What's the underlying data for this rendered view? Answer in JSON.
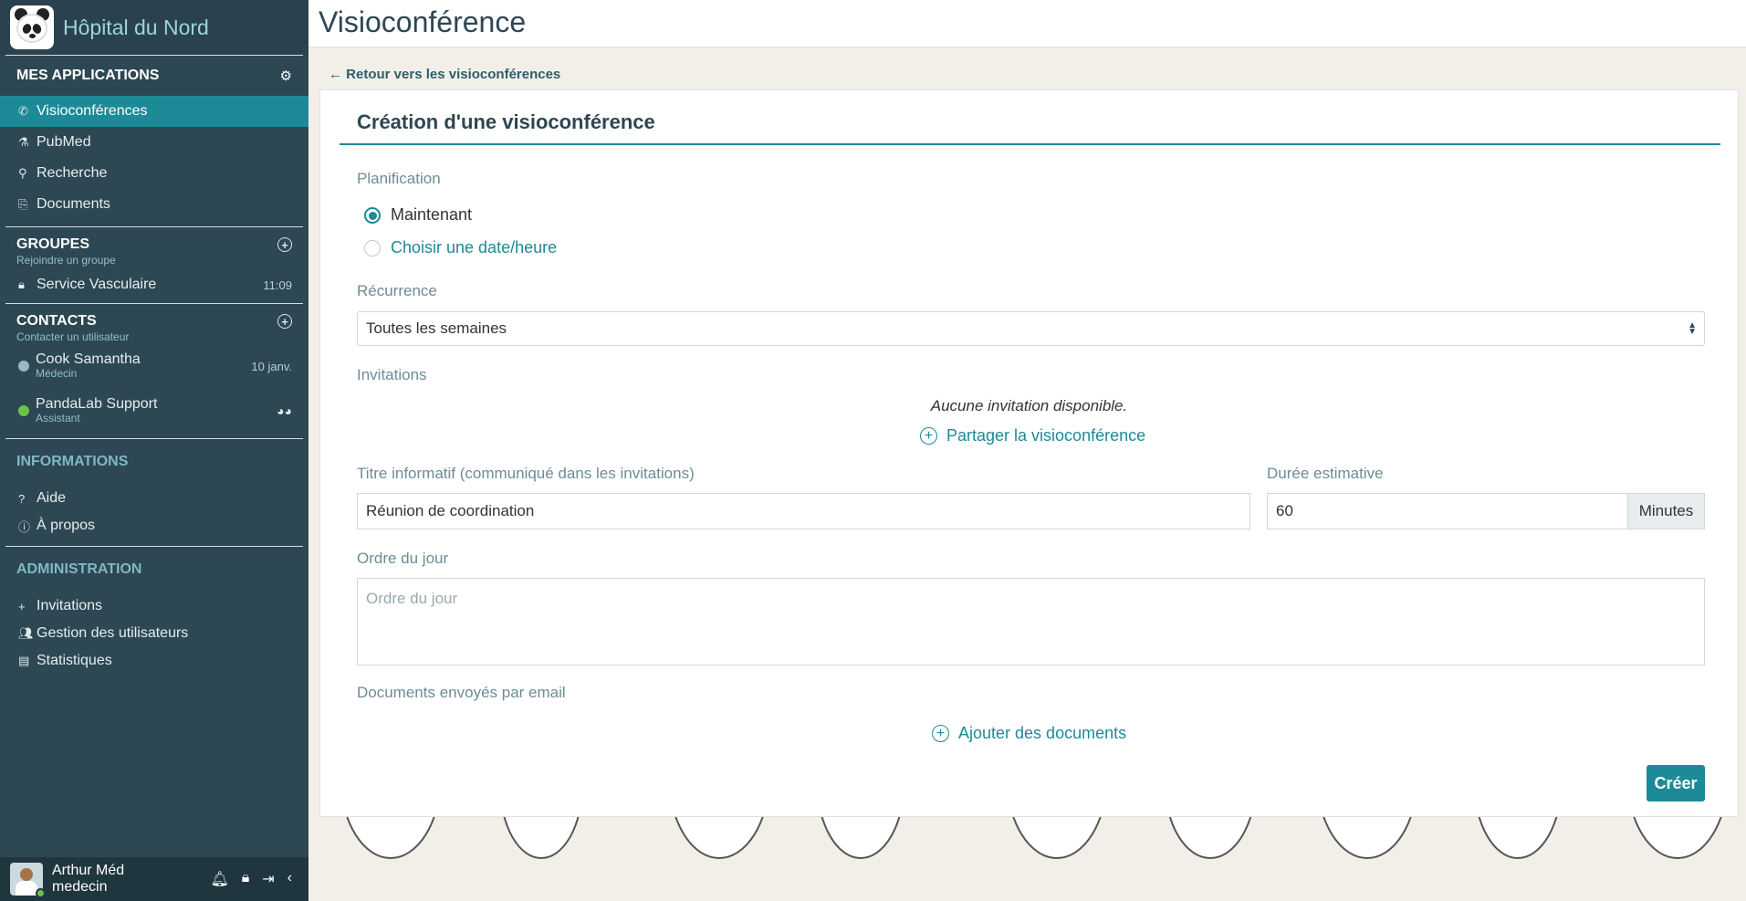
{
  "sidebar": {
    "brand": "Hôpital du Nord",
    "apps_title": "MES APPLICATIONS",
    "apps": [
      "Visioconférences",
      "PubMed",
      "Recherche",
      "Documents"
    ],
    "groups_title": "GROUPES",
    "groups_sub": "Rejoindre un groupe",
    "group_name": "Service Vasculaire",
    "group_time": "11:09",
    "contacts_title": "CONTACTS",
    "contacts_sub": "Contacter un utilisateur",
    "contact1_name": "Cook Samantha",
    "contact1_role": "Médecin",
    "contact1_date": "10 janv.",
    "contact2_name": "PandaLab Support",
    "contact2_role": "Assistant",
    "info_title": "INFORMATIONS",
    "info_items": [
      "Aide",
      "À propos"
    ],
    "admin_title": "ADMINISTRATION",
    "admin_items": [
      "Invitations",
      "Gestion des utilisateurs",
      "Statistiques"
    ],
    "user_name": "Arthur Méd",
    "user_role": "medecin"
  },
  "page": {
    "title": "Visioconférence",
    "back": "Retour vers les visioconférences"
  },
  "form": {
    "card_title": "Création d'une visioconférence",
    "planning_label": "Planification",
    "radio_now": "Maintenant",
    "radio_date": "Choisir une date/heure",
    "recurrence_label": "Récurrence",
    "recurrence_value": "Toutes les semaines",
    "invitations_label": "Invitations",
    "no_invitation": "Aucune invitation disponible.",
    "share": "Partager la visioconférence",
    "title_label": "Titre informatif (communiqué dans les invitations)",
    "title_value": "Réunion de coordination",
    "duration_label": "Durée estimative",
    "duration_value": "60",
    "duration_unit": "Minutes",
    "agenda_label": "Ordre du jour",
    "agenda_placeholder": "Ordre du jour",
    "docs_label": "Documents envoyés par email",
    "add_docs": "Ajouter des documents",
    "create": "Créer"
  },
  "colors": {
    "accent": "#1d8a98",
    "sidebar": "#2d4753"
  }
}
